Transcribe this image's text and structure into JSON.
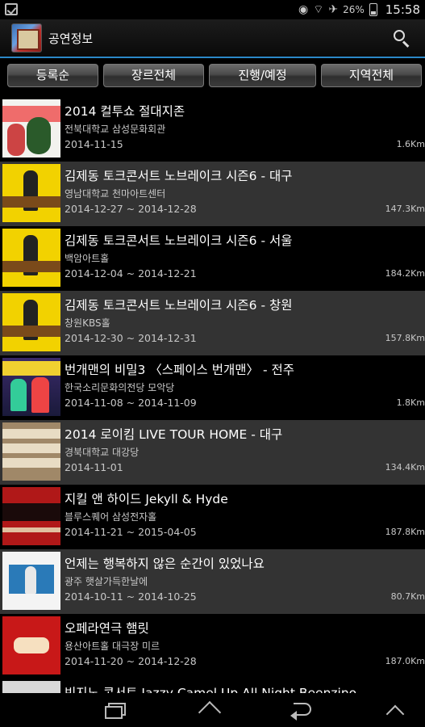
{
  "status_bar": {
    "battery": "26%",
    "time": "15:58",
    "icons": [
      "checkbox-icon",
      "eye-icon",
      "wifi-icon",
      "airplane-icon",
      "battery-icon"
    ]
  },
  "app_bar": {
    "title": "공연정보",
    "search_icon": "search-icon"
  },
  "filters": [
    {
      "label": "등록순"
    },
    {
      "label": "장르전체"
    },
    {
      "label": "진행/예정"
    },
    {
      "label": "지역전체"
    }
  ],
  "events": [
    {
      "title": "2014 컬투쇼 절대지존",
      "venue": "전북대학교 삼성문화회관",
      "date": "2014-11-15",
      "distance": "1.6Km"
    },
    {
      "title": "김제동 토크콘서트 노브레이크 시즌6 - 대구",
      "venue": "영남대학교 천마아트센터",
      "date": "2014-12-27 ~ 2014-12-28",
      "distance": "147.3Km"
    },
    {
      "title": "김제동 토크콘서트 노브레이크 시즌6 - 서울",
      "venue": "백암아트홀",
      "date": "2014-12-04 ~ 2014-12-21",
      "distance": "184.2Km"
    },
    {
      "title": "김제동 토크콘서트 노브레이크 시즌6 - 창원",
      "venue": "창원KBS홀",
      "date": "2014-12-30 ~ 2014-12-31",
      "distance": "157.8Km"
    },
    {
      "title": "번개맨의 비밀3 〈스페이스 번개맨〉 - 전주",
      "venue": "한국소리문화의전당 모악당",
      "date": "2014-11-08 ~ 2014-11-09",
      "distance": "1.8Km"
    },
    {
      "title": "2014 로이킴 LIVE TOUR HOME - 대구",
      "venue": "경북대학교 대강당",
      "date": "2014-11-01",
      "distance": "134.4Km"
    },
    {
      "title": "지킬 앤 하이드 Jekyll & Hyde",
      "venue": "블루스퀘어 삼성전자홀",
      "date": "2014-11-21 ~ 2015-04-05",
      "distance": "187.8Km"
    },
    {
      "title": "언제는 행복하지 않은 순간이 있었나요",
      "venue": "광주 햇살가득한날에",
      "date": "2014-10-11 ~ 2014-10-25",
      "distance": "80.7Km"
    },
    {
      "title": "오페라연극 햄릿",
      "venue": "용산아트홀 대극장 미르",
      "date": "2014-11-20 ~ 2014-12-28",
      "distance": "187.0Km"
    }
  ],
  "partial_event": {
    "title": "빈지노 콘서트 Jazzy Camel Up All Night Beenzino"
  },
  "nav_bar": {
    "icons": [
      "recent-apps-icon",
      "home-icon",
      "back-icon",
      "up-chevron-icon"
    ]
  }
}
